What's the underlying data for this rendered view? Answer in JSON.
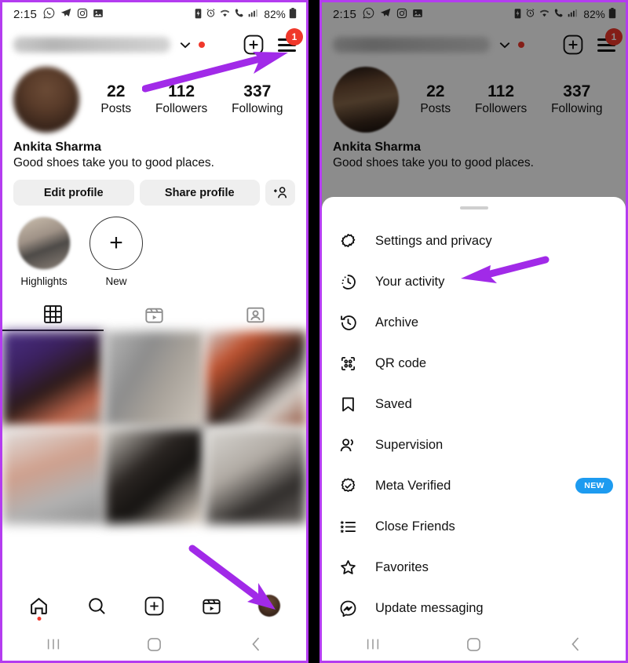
{
  "statusbar": {
    "time": "2:15",
    "battery": "82%",
    "left_icons": [
      "whatsapp-icon",
      "telegram-icon",
      "instagram-icon",
      "gallery-icon"
    ],
    "right_icons": [
      "battery-saver-icon",
      "alarm-icon",
      "wifi-icon",
      "call-icon",
      "signal-icon",
      "battery-icon"
    ]
  },
  "header": {
    "username_hidden": "",
    "chevron": "chevron-down-icon",
    "new_post": "plus-box-icon",
    "menu": "hamburger-menu-icon",
    "menu_badge": "1"
  },
  "profile": {
    "name": "Ankita Sharma",
    "bio": "Good shoes take you to good places.",
    "stats": [
      {
        "num": "22",
        "label": "Posts"
      },
      {
        "num": "112",
        "label": "Followers"
      },
      {
        "num": "337",
        "label": "Following"
      }
    ],
    "actions": {
      "edit": "Edit profile",
      "share": "Share profile",
      "add_person_icon": "add-person-icon"
    },
    "highlights": [
      {
        "label": "Highlights",
        "type": "cover"
      },
      {
        "label": "New",
        "type": "add"
      }
    ],
    "tabs": [
      {
        "name": "grid-tab",
        "icon": "grid-icon",
        "active": true
      },
      {
        "name": "reels-tab",
        "icon": "reels-icon",
        "active": false
      },
      {
        "name": "tagged-tab",
        "icon": "tagged-icon",
        "active": false
      }
    ]
  },
  "bottom_nav": [
    {
      "name": "home-nav",
      "icon": "home-icon",
      "badge_dot": true
    },
    {
      "name": "search-nav",
      "icon": "search-icon",
      "badge_dot": false
    },
    {
      "name": "create-nav",
      "icon": "plus-box-icon",
      "badge_dot": false
    },
    {
      "name": "reels-nav",
      "icon": "reels-icon",
      "badge_dot": false
    },
    {
      "name": "profile-nav",
      "icon": "avatar-icon",
      "badge_dot": false
    }
  ],
  "system_nav": {
    "recents": "recents-icon",
    "home": "home-square-icon",
    "back": "back-chevron-icon"
  },
  "sheet": {
    "grabber": "drag-handle",
    "items": [
      {
        "label": "Settings and privacy",
        "icon": "gear-icon",
        "badge": ""
      },
      {
        "label": "Your activity",
        "icon": "activity-clock-icon",
        "badge": ""
      },
      {
        "label": "Archive",
        "icon": "archive-clock-icon",
        "badge": ""
      },
      {
        "label": "QR code",
        "icon": "qr-code-icon",
        "badge": ""
      },
      {
        "label": "Saved",
        "icon": "bookmark-icon",
        "badge": ""
      },
      {
        "label": "Supervision",
        "icon": "people-icon",
        "badge": ""
      },
      {
        "label": "Meta Verified",
        "icon": "verified-badge-icon",
        "badge": "NEW"
      },
      {
        "label": "Close Friends",
        "icon": "close-friends-icon",
        "badge": ""
      },
      {
        "label": "Favorites",
        "icon": "star-icon",
        "badge": ""
      },
      {
        "label": "Update messaging",
        "icon": "messenger-icon",
        "badge": ""
      }
    ]
  },
  "annotations": {
    "arrow_color": "#a12ae8",
    "arrows": [
      {
        "name": "arrow-to-hamburger-menu"
      },
      {
        "name": "arrow-to-profile-nav"
      },
      {
        "name": "arrow-to-your-activity"
      }
    ]
  },
  "colors": {
    "accent_purple": "#b43cf0",
    "badge_red": "#f0382b",
    "badge_blue": "#1d9bf0"
  }
}
